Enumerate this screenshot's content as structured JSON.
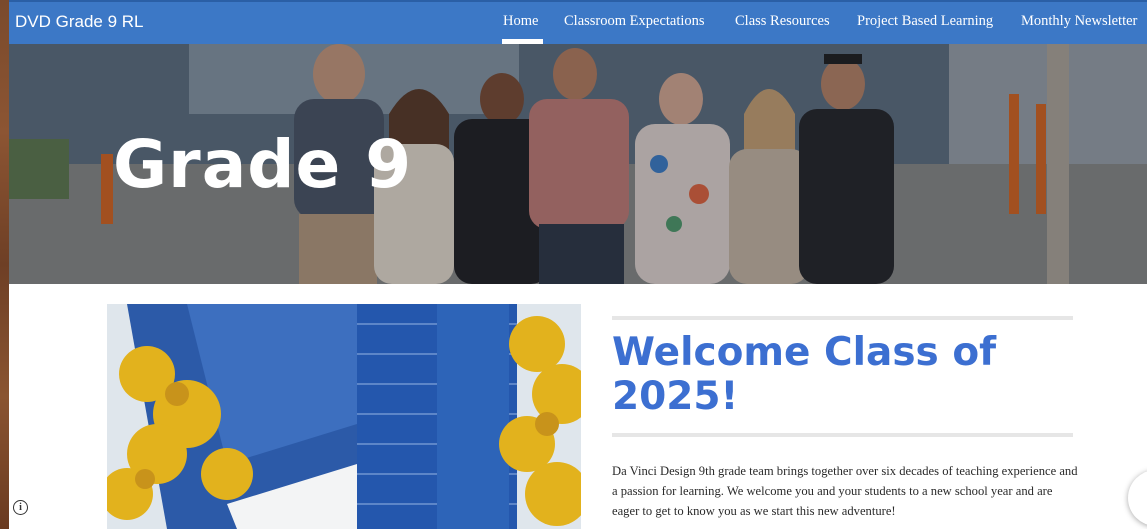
{
  "site_title": "DVD Grade 9 RL",
  "nav": {
    "items": [
      {
        "label": "Home",
        "active": true
      },
      {
        "label": "Classroom Expectations",
        "active": false
      },
      {
        "label": "Class Resources",
        "active": false
      },
      {
        "label": "Project Based Learning",
        "active": false
      },
      {
        "label": "Monthly Newsletter",
        "active": false
      }
    ]
  },
  "hero": {
    "title": "Grade 9",
    "image": "group-photo-of-teachers"
  },
  "main": {
    "image": "school-building-with-yellow-ginkgo-trees",
    "heading": "Welcome Class of 2025!",
    "body": "Da Vinci Design 9th grade team brings together over six decades of teaching experience and a passion for learning. We welcome you and your students to a new school year and are eager to get to know you as we start this new adventure!"
  },
  "footer": {
    "info_icon": "info-icon",
    "info_glyph": "i"
  },
  "colors": {
    "navbar": "#3c78c6",
    "heading": "#3c6fd1",
    "text": "#2a2a2a"
  }
}
